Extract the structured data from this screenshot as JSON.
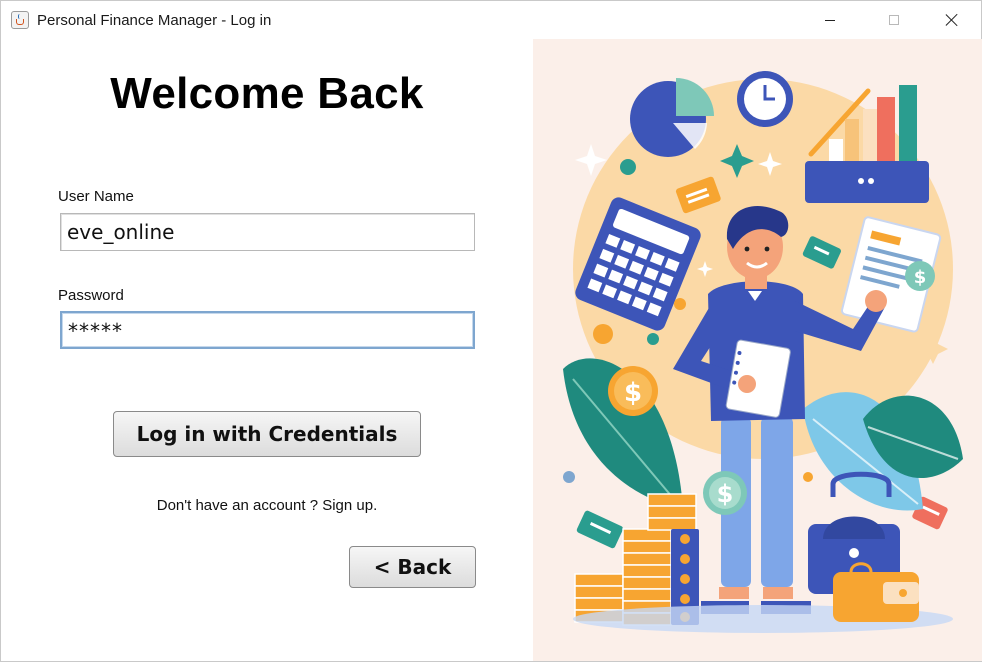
{
  "window": {
    "title": "Personal Finance Manager - Log in"
  },
  "form": {
    "heading": "Welcome Back",
    "username_label": "User Name",
    "username_value": "eve_online",
    "password_label": "Password",
    "password_value": "*****",
    "login_button": "Log in with Credentials",
    "signup_text": "Don't have an account ? Sign up.",
    "back_button": "< Back"
  },
  "illustration": {
    "badges": [
      "$",
      "$",
      "$"
    ]
  },
  "colors": {
    "field_focus_border": "#7ea6cf",
    "illustration_bg": "#fbefe9",
    "accent_blue": "#3d55b8",
    "accent_teal": "#2a9d8f",
    "accent_orange": "#f7a531"
  }
}
